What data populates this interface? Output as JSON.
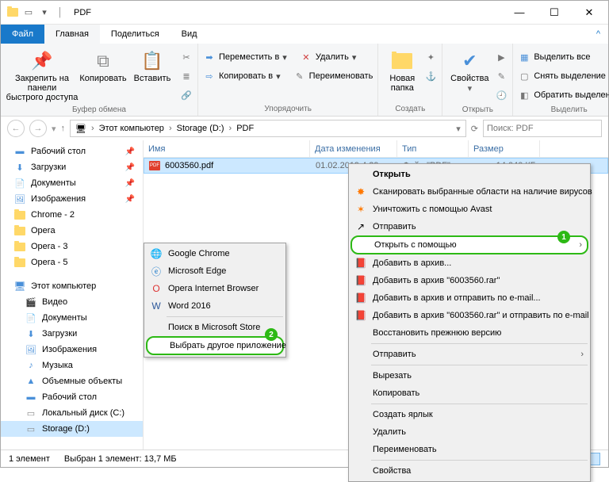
{
  "title": "PDF",
  "tabs": {
    "file": "Файл",
    "home": "Главная",
    "share": "Поделиться",
    "view": "Вид"
  },
  "ribbon": {
    "pin": "Закрепить на панели\nбыстрого доступа",
    "copy": "Копировать",
    "paste": "Вставить",
    "clipboard": "Буфер обмена",
    "moveTo": "Переместить в",
    "copyTo": "Копировать в",
    "delete": "Удалить",
    "rename": "Переименовать",
    "organize": "Упорядочить",
    "newFolder": "Новая\nпапка",
    "new": "Создать",
    "properties": "Свойства",
    "open": "Открыть",
    "selectAll": "Выделить все",
    "selectNone": "Снять выделение",
    "invert": "Обратить выделение",
    "select": "Выделить"
  },
  "breadcrumb": [
    "Этот компьютер",
    "Storage (D:)",
    "PDF"
  ],
  "searchPlaceholder": "Поиск: PDF",
  "columns": {
    "name": "Имя",
    "date": "Дата изменения",
    "type": "Тип",
    "size": "Размер"
  },
  "file": {
    "name": "6003560.pdf",
    "date": "01.02.2019 4:29",
    "type": "Файл \"PDF\"",
    "size": "14 040 КБ"
  },
  "side": {
    "quick": [
      {
        "label": "Рабочий стол",
        "icon": "desktop"
      },
      {
        "label": "Загрузки",
        "icon": "download"
      },
      {
        "label": "Документы",
        "icon": "docs"
      },
      {
        "label": "Изображения",
        "icon": "images"
      },
      {
        "label": "Chrome - 2",
        "icon": "folder"
      },
      {
        "label": "Opera",
        "icon": "folder"
      },
      {
        "label": "Opera - 3",
        "icon": "folder"
      },
      {
        "label": "Opera - 5",
        "icon": "folder"
      }
    ],
    "pc": "Этот компьютер",
    "pcItems": [
      {
        "label": "Видео",
        "icon": "video"
      },
      {
        "label": "Документы",
        "icon": "docs"
      },
      {
        "label": "Загрузки",
        "icon": "download"
      },
      {
        "label": "Изображения",
        "icon": "images"
      },
      {
        "label": "Музыка",
        "icon": "music"
      },
      {
        "label": "Объемные объекты",
        "icon": "3d"
      },
      {
        "label": "Рабочий стол",
        "icon": "desktop"
      },
      {
        "label": "Локальный диск (C:)",
        "icon": "disk"
      },
      {
        "label": "Storage (D:)",
        "icon": "disk",
        "active": true
      }
    ]
  },
  "status": {
    "count": "1 элемент",
    "sel": "Выбран 1 элемент: 13,7 МБ"
  },
  "ctxMain": {
    "open": "Открыть",
    "scan": "Сканировать выбранные области на наличие вирусов",
    "shred": "Уничтожить с помощью Avast",
    "share": "Отправить",
    "openWith": "Открыть с помощью",
    "addArchive": "Добавить в архив...",
    "addRar": "Добавить в архив \"6003560.rar\"",
    "addEmail": "Добавить в архив и отправить по e-mail...",
    "addRarEmail": "Добавить в архив \"6003560.rar\" и отправить по e-mail",
    "restore": "Восстановить прежнюю версию",
    "sendTo": "Отправить",
    "cut": "Вырезать",
    "copy": "Копировать",
    "shortcut": "Создать ярлык",
    "delete": "Удалить",
    "rename": "Переименовать",
    "props": "Свойства"
  },
  "ctxSub": {
    "chrome": "Google Chrome",
    "edge": "Microsoft Edge",
    "opera": "Opera Internet Browser",
    "word": "Word 2016",
    "store": "Поиск в Microsoft Store",
    "choose": "Выбрать другое приложение"
  }
}
